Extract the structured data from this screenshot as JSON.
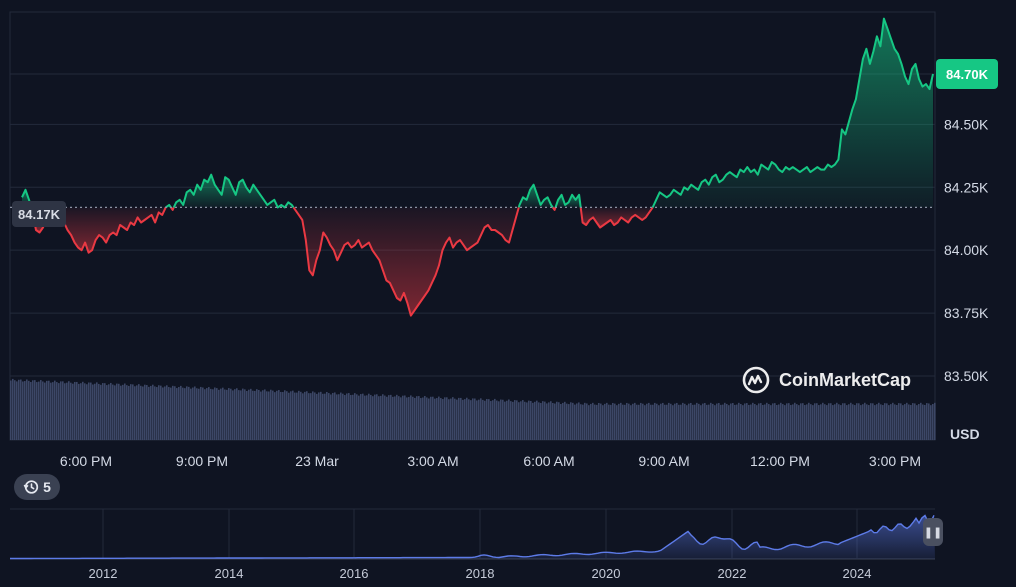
{
  "chart_data": {
    "type": "line",
    "currency_label": "USD",
    "watermark": "CoinMarketCap",
    "y_ticks": [
      "84.50K",
      "84.25K",
      "84.00K",
      "83.75K",
      "83.50K"
    ],
    "y_tick_values": [
      84500,
      84250,
      84000,
      83750,
      83500
    ],
    "x_ticks": [
      "6:00 PM",
      "9:00 PM",
      "23 Mar",
      "3:00 AM",
      "6:00 AM",
      "9:00 AM",
      "12:00 PM",
      "3:00 PM"
    ],
    "reference_price": 84170,
    "reference_label": "84.17K",
    "current_price": 84700,
    "current_label": "84.70K",
    "ylim": [
      83440,
      84950
    ],
    "colors": {
      "up": "#16c784",
      "down": "#ea3943",
      "reference": "#8b92a3",
      "volume": "#3c4766",
      "navigator": "#5d7be8"
    },
    "series": [
      {
        "values": [
          84210,
          84240,
          84200,
          84150,
          84080,
          84070,
          84090,
          84120,
          84150,
          84140,
          84180,
          84160,
          84110,
          84080,
          84060,
          84030,
          84010,
          84000,
          84030,
          83990,
          84000,
          84040,
          84060,
          84050,
          84030,
          84060,
          84070,
          84060,
          84100,
          84090,
          84080,
          84110,
          84100,
          84130,
          84110,
          84120,
          84130,
          84140,
          84110,
          84150,
          84140,
          84170,
          84180,
          84160,
          84190,
          84200,
          84180,
          84230,
          84240,
          84220,
          84260,
          84240,
          84280,
          84270,
          84300,
          84260,
          84240,
          84220,
          84290,
          84280,
          84250,
          84220,
          84270,
          84280,
          84250,
          84230,
          84260,
          84240,
          84220,
          84200,
          84180,
          84190,
          84200,
          84170,
          84180,
          84170,
          84190,
          84180,
          84160,
          84140,
          84120,
          84040,
          83920,
          83900,
          83960,
          84000,
          84070,
          84050,
          84020,
          84000,
          83960,
          83990,
          84020,
          84030,
          84010,
          84020,
          84040,
          84010,
          84020,
          84030,
          84000,
          83980,
          83960,
          83920,
          83880,
          83870,
          83840,
          83810,
          83800,
          83830,
          83790,
          83740,
          83760,
          83780,
          83800,
          83820,
          83840,
          83870,
          83900,
          83940,
          84000,
          84030,
          84050,
          84010,
          84030,
          84040,
          84020,
          84000,
          84010,
          84020,
          84030,
          84060,
          84090,
          84100,
          84080,
          84080,
          84070,
          84060,
          84040,
          84030,
          84080,
          84130,
          84180,
          84210,
          84200,
          84240,
          84260,
          84220,
          84180,
          84200,
          84210,
          84180,
          84160,
          84200,
          84220,
          84180,
          84190,
          84220,
          84200,
          84220,
          84110,
          84100,
          84120,
          84130,
          84110,
          84090,
          84100,
          84110,
          84120,
          84100,
          84110,
          84130,
          84120,
          84110,
          84130,
          84140,
          84130,
          84120,
          84130,
          84150,
          84170,
          84200,
          84230,
          84220,
          84210,
          84220,
          84240,
          84230,
          84220,
          84250,
          84240,
          84260,
          84250,
          84240,
          84270,
          84280,
          84260,
          84290,
          84300,
          84270,
          84280,
          84300,
          84310,
          84300,
          84290,
          84320,
          84310,
          84330,
          84310,
          84320,
          84300,
          84340,
          84330,
          84320,
          84350,
          84340,
          84320,
          84310,
          84330,
          84320,
          84330,
          84320,
          84310,
          84320,
          84330,
          84310,
          84320,
          84330,
          84320,
          84320,
          84340,
          84330,
          84340,
          84360,
          84480,
          84460,
          84510,
          84560,
          84600,
          84680,
          84760,
          84800,
          84740,
          84790,
          84850,
          84810,
          84920,
          84880,
          84840,
          84800,
          84780,
          84740,
          84690,
          84660,
          84720,
          84740,
          84680,
          84650,
          84660,
          84640,
          84700
        ]
      }
    ],
    "navigator": {
      "x_ticks": [
        "2012",
        "2014",
        "2016",
        "2018",
        "2020",
        "2022",
        "2024"
      ]
    }
  }
}
